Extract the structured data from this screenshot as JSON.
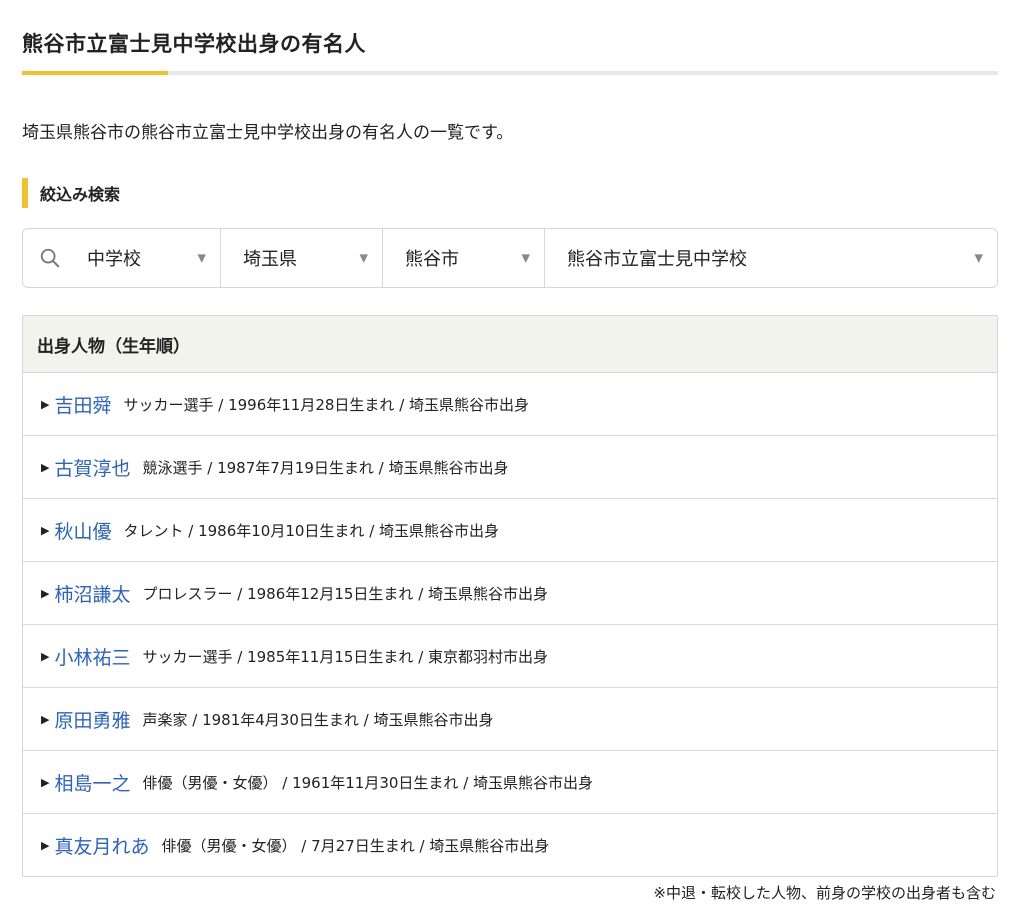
{
  "page": {
    "title": "熊谷市立富士見中学校出身の有名人",
    "intro": "埼玉県熊谷市の熊谷市立富士見中学校出身の有名人の一覧です。",
    "accent_color": "#f2c12e",
    "link_color": "#2a62c9"
  },
  "filter": {
    "section_title": "絞込み検索",
    "search_icon": "search-icon",
    "school_type": "中学校",
    "prefecture": "埼玉県",
    "city": "熊谷市",
    "school": "熊谷市立富士見中学校",
    "caret": "▼"
  },
  "list": {
    "header": "出身人物（生年順）",
    "bullet": "▶",
    "items": [
      {
        "name": "吉田舜",
        "info": "サッカー選手 / 1996年11月28日生まれ / 埼玉県熊谷市出身"
      },
      {
        "name": "古賀淳也",
        "info": "競泳選手 / 1987年7月19日生まれ / 埼玉県熊谷市出身"
      },
      {
        "name": "秋山優",
        "info": "タレント / 1986年10月10日生まれ / 埼玉県熊谷市出身"
      },
      {
        "name": "柿沼謙太",
        "info": "プロレスラー / 1986年12月15日生まれ / 埼玉県熊谷市出身"
      },
      {
        "name": "小林祐三",
        "info": "サッカー選手 / 1985年11月15日生まれ / 東京都羽村市出身"
      },
      {
        "name": "原田勇雅",
        "info": "声楽家 / 1981年4月30日生まれ / 埼玉県熊谷市出身"
      },
      {
        "name": "相島一之",
        "info": "俳優（男優・女優） / 1961年11月30日生まれ / 埼玉県熊谷市出身"
      },
      {
        "name": "真友月れあ",
        "info": "俳優（男優・女優） / 7月27日生まれ / 埼玉県熊谷市出身"
      }
    ]
  },
  "footnote": "※中退・転校した人物、前身の学校の出身者も含む"
}
